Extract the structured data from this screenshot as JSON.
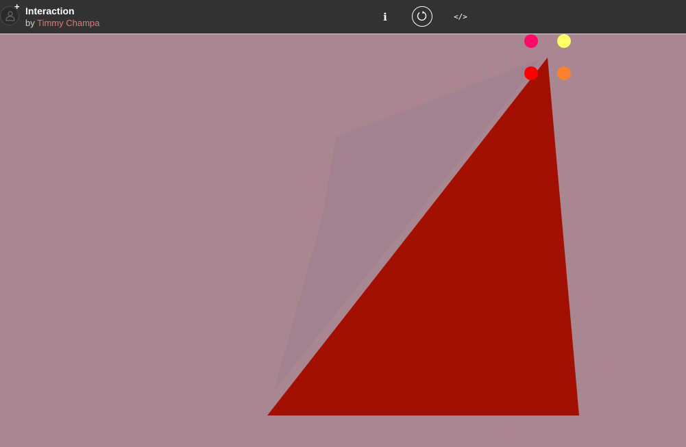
{
  "header": {
    "title": "Interaction",
    "byline_prefix": "by ",
    "author": "Timmy Champa",
    "info_label": "i",
    "code_label": "</>",
    "icons": {
      "avatar": "user-avatar-icon",
      "follow": "plus-icon",
      "restart": "restart-icon"
    }
  },
  "canvas": {
    "background_color": "#a88791",
    "triangle_color": "#a30f00",
    "ghost_color": "#9c7d91",
    "trail_color": "#b58191",
    "control_points": [
      {
        "name": "control-point-pink",
        "color": "#ff0a6a"
      },
      {
        "name": "control-point-yellow",
        "color": "#ffff66"
      },
      {
        "name": "control-point-red",
        "color": "#ff0000"
      },
      {
        "name": "control-point-orange",
        "color": "#ff7f2e"
      }
    ]
  }
}
